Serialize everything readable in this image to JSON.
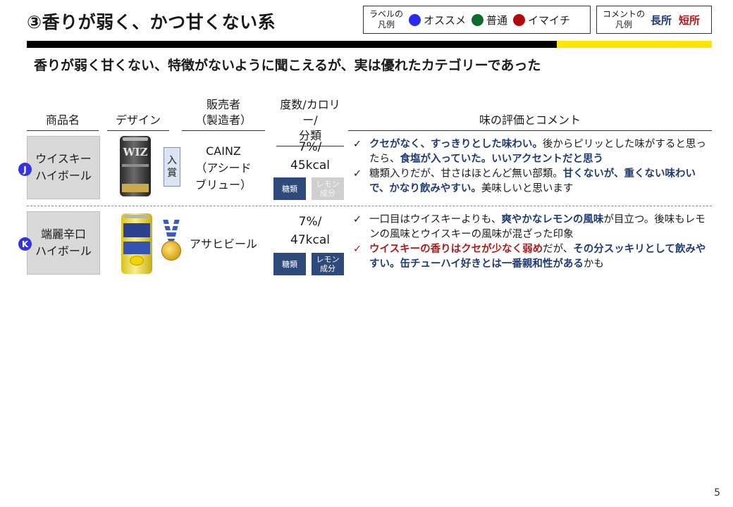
{
  "header": {
    "title": "③香りが弱く、かつ甘くない系",
    "subtitle": "香りが弱く甘くない、特徴がないように聞こえるが、実は優れたカテゴリーであった"
  },
  "legend_label": {
    "caption_line1": "ラベルの",
    "caption_line2": "凡例",
    "items": [
      {
        "label": "オススメ",
        "color": "#2b2bf0"
      },
      {
        "label": "普通",
        "color": "#0e6b2e"
      },
      {
        "label": "イマイチ",
        "color": "#b00a0a"
      }
    ]
  },
  "legend_comment": {
    "caption_line1": "コメントの",
    "caption_line2": "凡例",
    "strength": "長所",
    "weakness": "短所"
  },
  "columns": {
    "product": "商品名",
    "design": "デザイン",
    "seller_line1": "販売者",
    "seller_line2": "（製造者）",
    "spec_line1": "度数/カロリー/",
    "spec_line2": "分類",
    "taste": "味の評価とコメント"
  },
  "rows": [
    {
      "badge": "J",
      "badge_color": "#3333e0",
      "name_line1": "ウイスキー",
      "name_line2": "ハイボール",
      "can_logo": "WIZ",
      "award_line1": "入",
      "award_line2": "賞",
      "seller_line1": "CAINZ",
      "seller_line2": "（アシード",
      "seller_line3": "ブリュー）",
      "abv": "7%/",
      "kcal": "45kcal",
      "tag1": "糖類",
      "tag2_line1": "レモン",
      "tag2_line2": "成分",
      "comments": [
        {
          "tick": "✓",
          "parts": [
            {
              "t": "クセがなく、すっきりとした味わい。",
              "k": "s"
            },
            {
              "t": "後からピリッとした味がすると思ったら、",
              "k": "n"
            },
            {
              "t": "食塩が入っていた。いいアクセントだと思う",
              "k": "s"
            }
          ]
        },
        {
          "tick": "✓",
          "parts": [
            {
              "t": "糖類入りだが、甘さはほとんど無い部類。",
              "k": "n"
            },
            {
              "t": "甘くないが、重くない味わいで、かなり飲みやすい。",
              "k": "s"
            },
            {
              "t": "美味しいと思います",
              "k": "n"
            }
          ]
        }
      ]
    },
    {
      "badge": "K",
      "badge_color": "#3333e0",
      "name_line1": "端麗辛口",
      "name_line2": "ハイボール",
      "seller_line1": "アサヒビール",
      "abv": "7%/",
      "kcal": "47kcal",
      "tag1": "糖類",
      "tag2_line1": "レモン",
      "tag2_line2": "成分",
      "comments": [
        {
          "tick": "✓",
          "tick_color": "dark",
          "parts": [
            {
              "t": "一口目はウイスキーよりも、",
              "k": "n"
            },
            {
              "t": "爽やかなレモンの風味",
              "k": "s"
            },
            {
              "t": "が目立つ。後味もレモンの風味とウイスキーの風味が混ざった印象",
              "k": "n"
            }
          ]
        },
        {
          "tick": "✓",
          "tick_color": "red",
          "parts": [
            {
              "t": "ウイスキーの香りはクセが少なく弱め",
              "k": "w"
            },
            {
              "t": "だが、",
              "k": "n"
            },
            {
              "t": "その分スッキリとして飲みやすい。缶チューハイ好きとは一番親和性がある",
              "k": "s"
            },
            {
              "t": "かも",
              "k": "n"
            }
          ]
        }
      ]
    }
  ],
  "page_number": "5"
}
